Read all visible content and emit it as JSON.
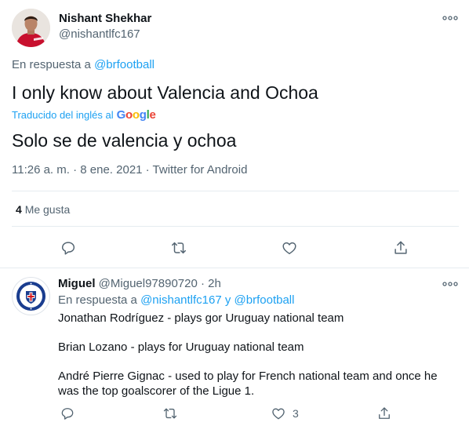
{
  "main_tweet": {
    "author_name": "Nishant Shekhar",
    "author_handle": "@nishantlfc167",
    "reply_prefix": "En respuesta a",
    "reply_handle": "@brfootball",
    "text": "I only know about Valencia and Ochoa",
    "translated_label": "Traducido del inglés al",
    "translation_provider": "Google",
    "translated_text": "Solo se de valencia y ochoa",
    "meta": "11:26 a. m. · 8 ene. 2021 · Twitter for Android",
    "likes_count": "4",
    "likes_label": "Me gusta"
  },
  "reply_tweet": {
    "author_name": "Miguel",
    "author_handle": "@Miguel97890720",
    "time_ago": "2h",
    "reply_prefix": "En respuesta a",
    "reply_handles": "@nishantlfc167 y @brfootball",
    "paragraphs": [
      "Jonathan Rodríguez - plays gor Uruguay national team",
      "Brian Lozano - plays for Uruguay national team",
      "André Pierre Gignac - used to play for French national team and once he was the top goalscorer of the Ligue 1."
    ],
    "likes_count": "3"
  },
  "icons": {
    "more": "more-icon",
    "reply": "reply-icon",
    "retweet": "retweet-icon",
    "like": "heart-icon",
    "share": "share-icon"
  },
  "colors": {
    "link": "#1da1f2",
    "text": "#0f1419",
    "secondary": "#536471",
    "divider": "#e6ecf0",
    "club_blue": "#1a3d8f",
    "club_red": "#d3181f"
  }
}
